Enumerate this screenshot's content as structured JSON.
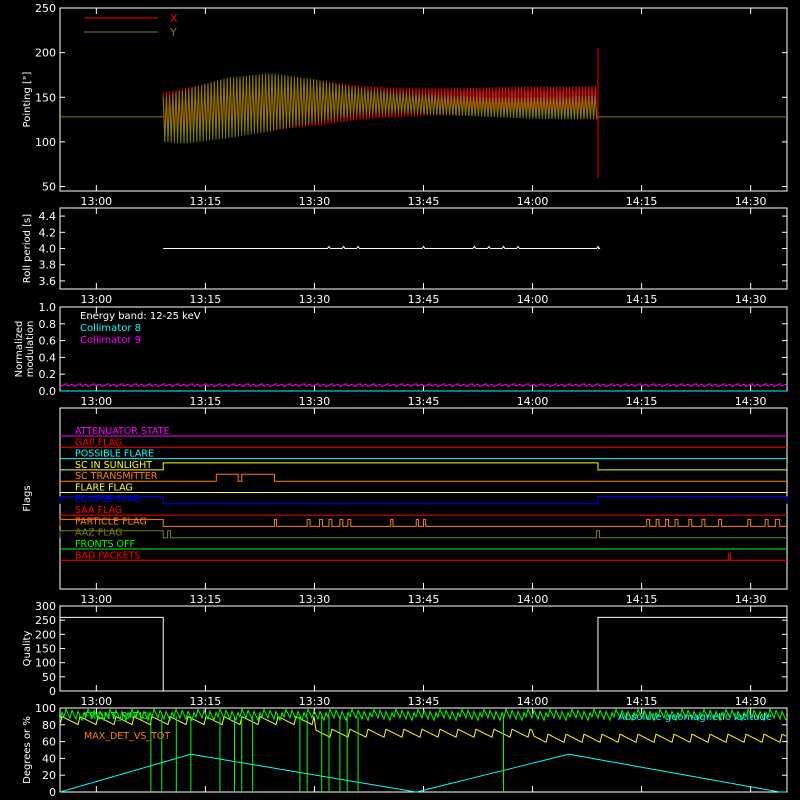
{
  "colors": {
    "background": "#000000",
    "axis": "#ffffff",
    "X": "#ff0000",
    "Y": "#808000",
    "roll": "#ffffff",
    "coll8": "#00ffff",
    "coll9": "#ff00ff",
    "quality": "#ffffff",
    "front_ratio": "#00ff00",
    "max_det": "#ffff00",
    "geomag": "#00ffff",
    "orange": "#ff8000"
  },
  "time_axis": {
    "range_min": [
      -5,
      95
    ],
    "ticks": [
      0,
      15,
      30,
      45,
      60,
      75,
      90
    ],
    "tick_labels": [
      "13:00",
      "13:15",
      "13:30",
      "13:45",
      "14:00",
      "14:15",
      "14:30"
    ]
  },
  "chart_data": [
    {
      "type": "line",
      "ylabel": "Pointing [\"]",
      "ylim": [
        45,
        250
      ],
      "yticks": [
        50,
        100,
        150,
        200,
        250
      ],
      "legend": [
        "X",
        "Y"
      ],
      "legend_placement": "top-left",
      "baseline": 128,
      "data_start_min": 9.2,
      "data_end_min": 69.0,
      "series": [
        {
          "name": "X",
          "envelope_t": [
            9.2,
            12,
            18,
            24,
            30,
            36,
            42,
            48,
            54,
            60,
            66,
            69
          ],
          "upper": [
            155,
            160,
            170,
            175,
            170,
            163,
            160,
            160,
            161,
            162,
            162,
            163
          ],
          "lower": [
            106,
            108,
            112,
            113,
            118,
            125,
            128,
            130,
            130,
            129,
            127,
            125
          ]
        },
        {
          "name": "Y",
          "envelope_t": [
            9.2,
            12,
            18,
            24,
            30,
            36,
            42,
            48,
            54,
            60,
            66,
            69
          ],
          "upper": [
            150,
            158,
            172,
            177,
            170,
            160,
            155,
            152,
            150,
            150,
            151,
            152
          ],
          "lower": [
            100,
            98,
            104,
            112,
            122,
            130,
            132,
            130,
            128,
            126,
            125,
            126
          ]
        }
      ]
    },
    {
      "type": "line",
      "ylabel": "Roll period [s]",
      "ylim": [
        3.5,
        4.5
      ],
      "yticks": [
        3.6,
        3.8,
        4.0,
        4.2,
        4.4
      ],
      "tick_labels": [
        "3.6",
        "3.8",
        "4.0",
        "4.2",
        "4.4"
      ],
      "series": [
        {
          "name": "Roll period",
          "t": [
            9.2,
            69
          ],
          "value": 4.0
        }
      ]
    },
    {
      "type": "line",
      "ylabel": "Normalized modulation",
      "ylim": [
        0,
        1.0
      ],
      "yticks": [
        0,
        0.2,
        0.4,
        0.6,
        0.8,
        1.0
      ],
      "tick_labels": [
        "0.0",
        "0.2",
        "0.4",
        "0.6",
        "0.8",
        "1.0"
      ],
      "annotation": "Energy band: 12-25 keV",
      "legend": [
        "Collimator 8",
        "Collimator 9"
      ],
      "series": [
        {
          "name": "Collimator 8",
          "value": 0.0
        },
        {
          "name": "Collimator 9",
          "value": 0.07
        }
      ]
    },
    {
      "type": "flags",
      "ylabel": "Flags",
      "rows": [
        {
          "label": "ATTENUATOR STATE",
          "color": "#ff00ff",
          "high": []
        },
        {
          "label": "GAP FLAG",
          "color": "#ff0000",
          "high": []
        },
        {
          "label": "POSSIBLE FLARE",
          "color": "#00ffff",
          "high": []
        },
        {
          "label": "SC IN SUNLIGHT",
          "color": "#ffff00",
          "high": [
            [
              9.2,
              69
            ]
          ]
        },
        {
          "label": "SC TRANSMITTER",
          "color": "#ff8000",
          "high": [
            [
              16.5,
              19.5
            ],
            [
              20,
              24.5
            ]
          ]
        },
        {
          "label": "FLARE FLAG",
          "color": "#ffff00",
          "high": []
        },
        {
          "label": "ECLIPSE FLAG",
          "color": "#0000ff",
          "high": [
            [
              -5,
              9.2
            ],
            [
              69,
              95
            ]
          ]
        },
        {
          "label": "SAA FLAG",
          "color": "#ff0000",
          "high": []
        },
        {
          "label": "PARTICLE FLAG",
          "color": "#ff8000",
          "high": [
            [
              -5,
              9.2
            ],
            [
              24.5,
              24.8
            ],
            [
              29,
              29.4
            ],
            [
              30.7,
              31.1
            ],
            [
              32,
              32.4
            ],
            [
              33.5,
              33.9
            ],
            [
              34.6,
              35
            ],
            [
              40.5,
              40.8
            ],
            [
              44,
              44.3
            ],
            [
              45,
              45.3
            ],
            [
              75.7,
              76.1
            ],
            [
              77,
              77.4
            ],
            [
              78.3,
              78.7
            ],
            [
              79.6,
              80
            ],
            [
              81.5,
              81.9
            ],
            [
              83.3,
              83.7
            ],
            [
              85.6,
              86
            ],
            [
              89.6,
              90
            ],
            [
              92,
              92.4
            ],
            [
              93.4,
              94
            ]
          ]
        },
        {
          "label": "AAZ FLAG",
          "color": "#808000",
          "high": [
            [
              -5,
              9.2
            ],
            [
              9.8,
              10.2
            ],
            [
              68.8,
              69.2
            ]
          ]
        },
        {
          "label": "FRONTS OFF",
          "color": "#00ff00",
          "high": []
        },
        {
          "label": "BAD PACKETS",
          "color": "#ff0000",
          "high": [
            [
              87,
              87.2
            ]
          ]
        }
      ]
    },
    {
      "type": "line",
      "ylabel": "Quality",
      "ylim": [
        0,
        300
      ],
      "yticks": [
        0,
        50,
        100,
        150,
        200,
        250,
        300
      ],
      "series": [
        {
          "name": "Quality",
          "t": [
            -5,
            9.2,
            9.2,
            69,
            69,
            95
          ],
          "values": [
            260,
            260,
            0,
            0,
            260,
            260
          ]
        }
      ]
    },
    {
      "type": "line",
      "ylabel": "Degrees or %",
      "ylim": [
        0,
        100
      ],
      "yticks": [
        0,
        20,
        40,
        60,
        80,
        100
      ],
      "legend": [
        "FRONT_RATIO",
        "MAX_DET_VS_TOT",
        "Absolute geomagnetic latitude"
      ],
      "series": [
        {
          "name": "FRONT_RATIO",
          "level": 92
        },
        {
          "name": "MAX_DET_VS_TOT",
          "segments": [
            {
              "t": [
                -5,
                30
              ],
              "level": 85
            },
            {
              "t": [
                30,
                60
              ],
              "level": 70
            },
            {
              "t": [
                60,
                95
              ],
              "level": 64
            }
          ]
        },
        {
          "name": "Absolute geomagnetic latitude",
          "t": [
            -5,
            13,
            44,
            65,
            94
          ],
          "values": [
            0,
            45,
            0,
            45,
            0
          ]
        }
      ]
    }
  ]
}
